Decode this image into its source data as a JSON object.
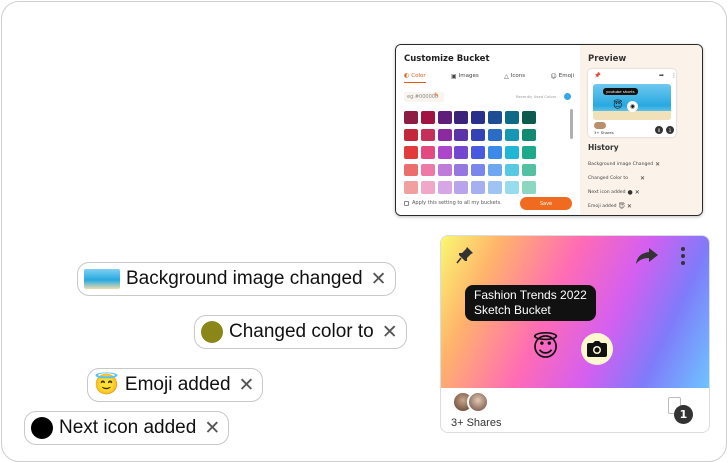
{
  "customize_bucket": {
    "title": "Customize Bucket",
    "tabs": [
      {
        "label": "Color",
        "icon": "palette-icon",
        "active": true
      },
      {
        "label": "Images",
        "icon": "image-icon",
        "active": false
      },
      {
        "label": "Icons",
        "icon": "shapes-icon",
        "active": false
      },
      {
        "label": "Emoji",
        "icon": "smiley-icon",
        "active": false
      }
    ],
    "hex_placeholder": "eg.#000000",
    "recently_used_label": "Recently Used Colors",
    "recently_used_color": "#35a9e6",
    "swatches": [
      [
        "#8d1c45",
        "#a01343",
        "#5e1e7a",
        "#3b2378",
        "#28308c",
        "#1f4d94",
        "#116a85",
        "#0c5a4d"
      ],
      [
        "#c3283a",
        "#c52f5a",
        "#8b2aa0",
        "#5b33a6",
        "#3343b5",
        "#2b6cc4",
        "#1697b3",
        "#128a72"
      ],
      [
        "#e23b3b",
        "#e34a82",
        "#ae46cb",
        "#7447d1",
        "#4a5ae0",
        "#3b8ae8",
        "#20b7d6",
        "#1caa8a"
      ],
      [
        "#ea6e6e",
        "#ec79a6",
        "#c07ad9",
        "#9477df",
        "#7a86ea",
        "#6ca7ef",
        "#59c8e2",
        "#53c0a2"
      ],
      [
        "#f0a0a0",
        "#f1a8c6",
        "#d6a6e6",
        "#b7a4ea",
        "#a5aff1",
        "#9dc4f3",
        "#97dced",
        "#8dd6c2"
      ]
    ],
    "apply_all_label": "Apply this setting to all my buckets.",
    "save_label": "Save"
  },
  "preview": {
    "title": "Preview",
    "tag": "youtube shorts",
    "emoji": "😇",
    "camera_icon": "camera-icon",
    "shares": "3+ Shares",
    "badge_a": "0",
    "badge_b": "1"
  },
  "history": {
    "title": "History",
    "items": [
      {
        "label": "Background image Changed",
        "icon": "close-icon"
      },
      {
        "label": "Changed Color to",
        "icon": "close-icon"
      },
      {
        "label": "Next icon added",
        "icon": "close-icon"
      },
      {
        "label": "Emoji added",
        "icon": "close-icon"
      }
    ]
  },
  "card": {
    "tag_line1": "Fashion Trends 2022",
    "tag_line2": "Sketch Bucket",
    "emoji": "😇",
    "shares": "3+ Shares",
    "count": "1"
  },
  "chips": [
    {
      "label": "Background image changed",
      "close": "✕"
    },
    {
      "label": "Changed color to",
      "close": "✕",
      "color": "#8a8618"
    },
    {
      "label": "Emoji added",
      "close": "✕",
      "emoji": "😇"
    },
    {
      "label": "Next icon added",
      "close": "✕",
      "color": "#000000"
    }
  ]
}
